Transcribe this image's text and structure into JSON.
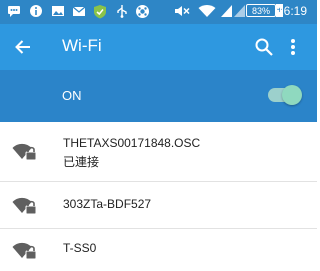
{
  "status_bar": {
    "time": "16:19",
    "battery": "83%",
    "battery_charging": "+",
    "icons": [
      "sms-icon",
      "info-icon",
      "image-icon",
      "mail-icon",
      "shield-icon",
      "usb-icon",
      "app-icon",
      "mute-icon",
      "wifi-icon",
      "signal-icon",
      "signal-icon"
    ]
  },
  "app_bar": {
    "title": "Wi-Fi",
    "back_icon": "arrow-back-icon",
    "search_icon": "search-icon",
    "menu_icon": "more-vert-icon"
  },
  "wifi_switch": {
    "label": "ON",
    "enabled": true
  },
  "networks": [
    {
      "name": "THETAXS00171848.OSC",
      "status": "已連接",
      "icon": "wifi-lock-icon"
    },
    {
      "name": "303ZTa-BDF527",
      "status": "",
      "icon": "wifi-lock-icon"
    },
    {
      "name": "T-SS0",
      "status": "",
      "icon": "wifi-lock-icon"
    }
  ],
  "colors": {
    "status_bar": "#2e86c6",
    "app_bar": "#2e98e0",
    "switch_bar": "#2b84c9",
    "toggle_on": "#8fd9bf"
  }
}
